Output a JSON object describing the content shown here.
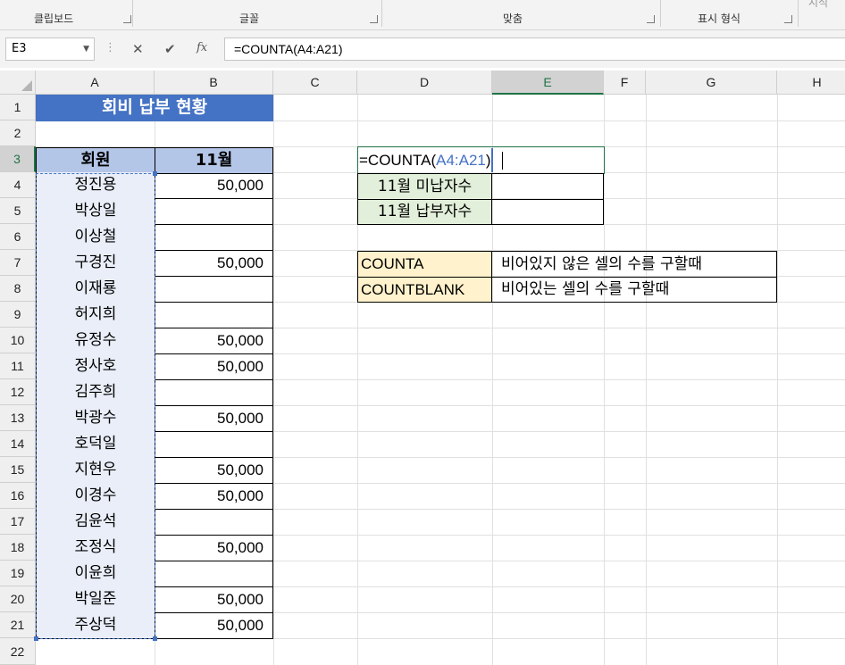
{
  "ribbon": {
    "groups": [
      {
        "label": "클립보드"
      },
      {
        "label": "글꼴"
      },
      {
        "label": "맞춤"
      },
      {
        "label": "표시 형식"
      },
      {
        "label": "시식"
      }
    ]
  },
  "formula_bar": {
    "name_box": "E3",
    "cancel": "✕",
    "enter": "✔",
    "fx": "fx",
    "formula": "=COUNTA(A4:A21)"
  },
  "columns": [
    "A",
    "B",
    "C",
    "D",
    "E",
    "F",
    "G",
    "H"
  ],
  "rows": [
    "1",
    "2",
    "3",
    "4",
    "5",
    "6",
    "7",
    "8",
    "9",
    "10",
    "11",
    "12",
    "13",
    "14",
    "15",
    "16",
    "17",
    "18",
    "19",
    "20",
    "21",
    "22"
  ],
  "sheet": {
    "title": "회비 납부 현황",
    "header_member": "회원",
    "header_month": "11월",
    "members": [
      {
        "name": "정진용",
        "amount": "50,000"
      },
      {
        "name": "박상일",
        "amount": ""
      },
      {
        "name": "이상철",
        "amount": ""
      },
      {
        "name": "구경진",
        "amount": "50,000"
      },
      {
        "name": "이재룡",
        "amount": ""
      },
      {
        "name": "허지희",
        "amount": ""
      },
      {
        "name": "유정수",
        "amount": "50,000"
      },
      {
        "name": "정사호",
        "amount": "50,000"
      },
      {
        "name": "김주희",
        "amount": ""
      },
      {
        "name": "박광수",
        "amount": "50,000"
      },
      {
        "name": "호덕일",
        "amount": ""
      },
      {
        "name": "지현우",
        "amount": "50,000"
      },
      {
        "name": "이경수",
        "amount": "50,000"
      },
      {
        "name": "김윤석",
        "amount": ""
      },
      {
        "name": "조정식",
        "amount": "50,000"
      },
      {
        "name": "이윤희",
        "amount": ""
      },
      {
        "name": "박일준",
        "amount": "50,000"
      },
      {
        "name": "주상덕",
        "amount": "50,000"
      }
    ],
    "editing_formula_prefix": "=COUNTA(",
    "editing_formula_ref": "A4:A21",
    "editing_formula_suffix": ")",
    "unpaid_label": "11월 미납자수",
    "paid_label": "11월 납부자수",
    "functions": [
      {
        "name": "COUNTA",
        "desc": "비어있지 않은 셀의 수를 구할때"
      },
      {
        "name": "COUNTBLANK",
        "desc": "비어있는 셀의 수를 구할때"
      }
    ]
  },
  "colors": {
    "title_bg": "#4472c4",
    "header_bg": "#b4c6e7",
    "member_bg": "#e9eef8",
    "label_bg": "#e2efda",
    "function_bg": "#fff2cc",
    "excel_green": "#217346"
  }
}
